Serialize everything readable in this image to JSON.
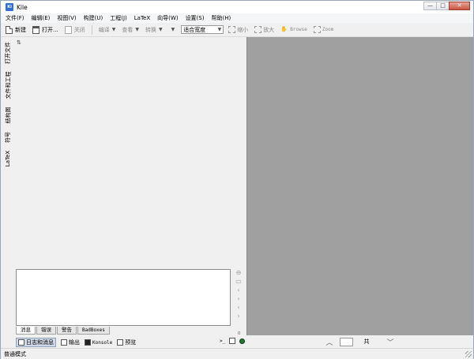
{
  "window": {
    "title": "Kile",
    "app_icon": "Ki"
  },
  "window_controls": {
    "minimize": "—",
    "maximize": "□",
    "close": "✕"
  },
  "menu": [
    "文件(F)",
    "编辑(E)",
    "视图(V)",
    "构建(U)",
    "工程(J)",
    "LaTeX",
    "向导(W)",
    "设置(S)",
    "帮助(H)"
  ],
  "toolbar": {
    "new_label": "新建",
    "open_label": "打开...",
    "close_label": "关闭",
    "compile_label": "编译",
    "view_label": "查看",
    "convert_label": "转换",
    "zoom_value": "适合宽度",
    "zoom_out_label": "缩小",
    "zoom_in_label": "放大",
    "browse_label": "Browse",
    "zoom_label": "Zoom"
  },
  "side_tabs": [
    "打开文件",
    "文件和工程",
    "结构图",
    "符号",
    "LaTeX"
  ],
  "bottom_tabs": [
    "消息",
    "错误",
    "警告",
    "BadBoxes"
  ],
  "bottom_tools": {
    "log_label": "日志和消息",
    "output_label": "输出",
    "konsole_label": "Konsole",
    "preview_label": "预览",
    "shell_prompt": ">_",
    "counter": "0"
  },
  "preview_nav": {
    "page_value": "",
    "total_label": "共"
  },
  "status": {
    "mode": "普通模式"
  },
  "colors": {
    "preview_bg": "#a0a0a0",
    "status_green": "#1f7a2e"
  }
}
